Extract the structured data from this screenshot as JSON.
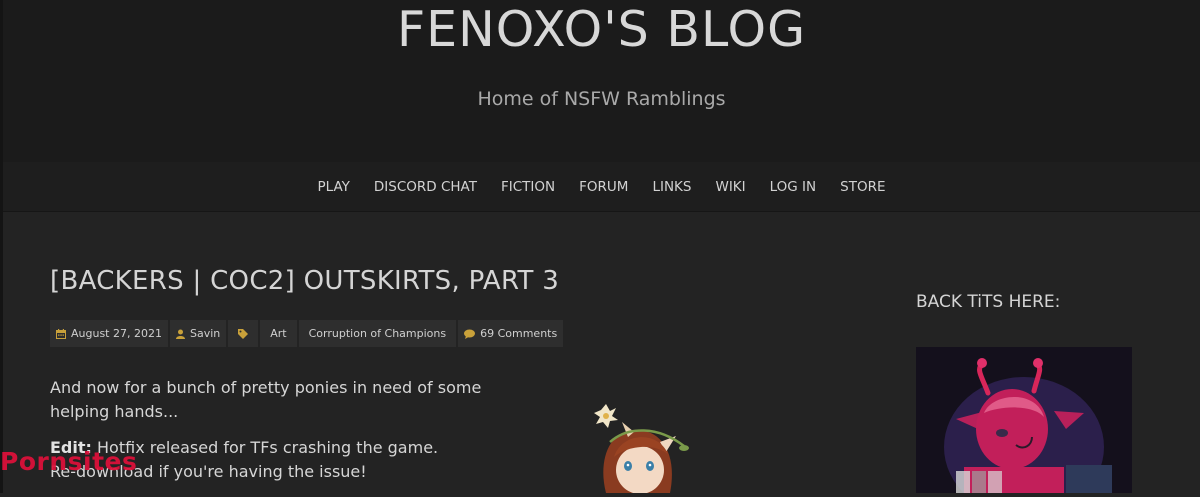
{
  "header": {
    "site_title": "FENOXO'S BLOG",
    "tagline": "Home of NSFW Ramblings"
  },
  "nav": {
    "items": [
      {
        "label": "PLAY"
      },
      {
        "label": "DISCORD CHAT"
      },
      {
        "label": "FICTION"
      },
      {
        "label": "FORUM"
      },
      {
        "label": "LINKS"
      },
      {
        "label": "WIKI"
      },
      {
        "label": "LOG IN"
      },
      {
        "label": "STORE"
      }
    ]
  },
  "post": {
    "title": "[BACKERS | COC2] OUTSKIRTS, PART 3",
    "meta": {
      "date": "August 27, 2021",
      "author": "Savin",
      "tags": [
        "Art",
        "Corruption of Champions"
      ],
      "comments": "69 Comments"
    },
    "body": {
      "intro": "And now for a bunch of pretty ponies in need of some helping hands...",
      "edit_label": "Edit:",
      "edit_text": "Hotfix released for TFs crashing the game.",
      "edit_text_2": "Re-download if you're having the issue!"
    }
  },
  "sidebar": {
    "heading": "BACK TiTS HERE:"
  },
  "watermark": {
    "text": "Pornsites"
  },
  "icons": {
    "date": "calendar-icon",
    "author": "user-icon",
    "tags": "tag-icon",
    "comments": "comment-icon"
  },
  "colors": {
    "background": "#232323",
    "header": "#1b1b1b",
    "meta_box": "#2e2e2e",
    "icon_accent": "#c9a13a",
    "watermark": "#e0103a"
  }
}
